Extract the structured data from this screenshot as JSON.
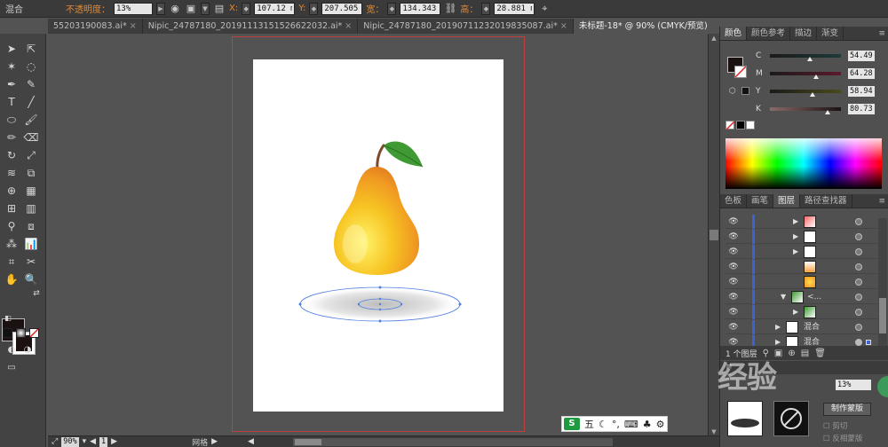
{
  "control_bar": {
    "mode_label": "混合",
    "opacity_label": "不透明度：",
    "opacity_value": "13%",
    "x_label": "X:",
    "x_value": "107.12 mm",
    "y_label": "Y:",
    "y_value": "207.505 m",
    "w_label": "宽：",
    "w_value": "134.343 m",
    "h_label": "高：",
    "h_value": "28.881 mm"
  },
  "tabs": [
    {
      "label": "55203190083.ai*",
      "active": false
    },
    {
      "label": "Nipic_24787180_20191113151526622032.ai*",
      "active": false
    },
    {
      "label": "Nipic_24787180_20190711232019835087.ai*",
      "active": false
    },
    {
      "label": "未标题-18* @ 90% (CMYK/预览)",
      "active": true
    }
  ],
  "color_panel": {
    "tabs": [
      "颜色",
      "颜色参考",
      "描边",
      "渐变"
    ],
    "channels": [
      {
        "name": "C",
        "value": "54.49",
        "pos": 0.55
      },
      {
        "name": "M",
        "value": "64.28",
        "pos": 0.64
      },
      {
        "name": "Y",
        "value": "58.94",
        "pos": 0.59
      },
      {
        "name": "K",
        "value": "80.73",
        "pos": 0.81
      }
    ]
  },
  "layers_panel": {
    "tabs": [
      "色板",
      "画笔",
      "图层",
      "路径查找器"
    ],
    "rows": [
      {
        "name": "",
        "indent": 2,
        "thumb": "red"
      },
      {
        "name": "",
        "indent": 2,
        "thumb": "white"
      },
      {
        "name": "",
        "indent": 2,
        "thumb": "white"
      },
      {
        "name": "",
        "indent": 3,
        "thumb": "orange"
      },
      {
        "name": "",
        "indent": 3,
        "thumb": "pear"
      },
      {
        "name": "<...",
        "indent": 1,
        "thumb": "leaf"
      },
      {
        "name": "",
        "indent": 2,
        "thumb": "leaf"
      },
      {
        "name": "混合",
        "indent": 0,
        "thumb": "white"
      },
      {
        "name": "混合",
        "indent": 0,
        "thumb": "white"
      }
    ],
    "footer_count": "1 个图层"
  },
  "transparency": {
    "opacity": "13%",
    "mask_button": "制作蒙版",
    "clip_label": "剪切",
    "invert_label": "反相蒙版"
  },
  "statusbar": {
    "zoom": "90%",
    "page": "1",
    "mode": "网格"
  },
  "watermark": "经验",
  "ime": {
    "logo": "S",
    "mode": "五"
  }
}
